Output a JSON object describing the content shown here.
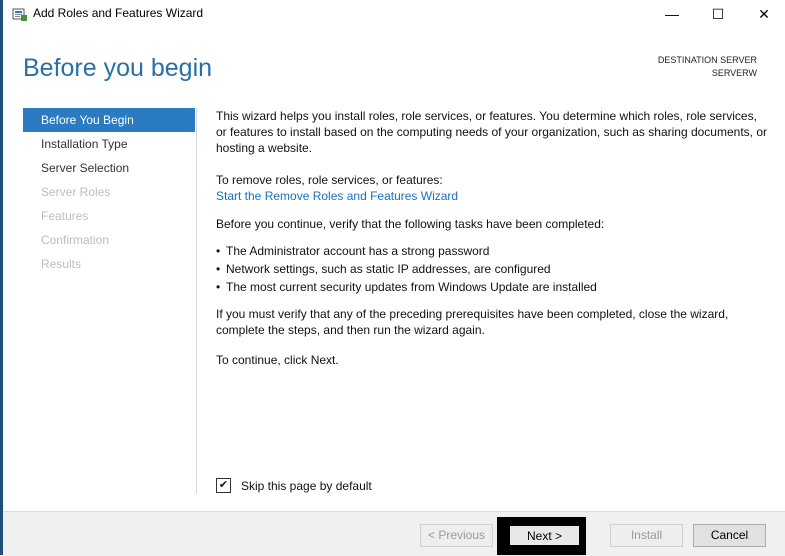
{
  "window": {
    "title": "Add Roles and Features Wizard",
    "minimize_glyph": "—",
    "maximize_glyph": "☐",
    "close_glyph": "✕"
  },
  "header": {
    "page_title": "Before you begin",
    "destination_label": "DESTINATION SERVER",
    "destination_server": "SERVERW"
  },
  "nav": {
    "items": [
      {
        "label": "Before You Begin"
      },
      {
        "label": "Installation Type"
      },
      {
        "label": "Server Selection"
      },
      {
        "label": "Server Roles"
      },
      {
        "label": "Features"
      },
      {
        "label": "Confirmation"
      },
      {
        "label": "Results"
      }
    ]
  },
  "content": {
    "intro": "This wizard helps you install roles, role services, or features. You determine which roles, role services, or features to install based on the computing needs of your organization, such as sharing documents, or hosting a website.",
    "remove_label": "To remove roles, role services, or features:",
    "remove_link": "Start the Remove Roles and Features Wizard",
    "verify_intro": "Before you continue, verify that the following tasks have been completed:",
    "bullets": [
      "The Administrator account has a strong password",
      "Network settings, such as static IP addresses, are configured",
      "The most current security updates from Windows Update are installed"
    ],
    "prereq_note": "If you must verify that any of the preceding prerequisites have been completed, close the wizard, complete the steps, and then run the wizard again.",
    "continue_note": "To continue, click Next."
  },
  "skip": {
    "label": "Skip this page by default",
    "checked_glyph": "✔"
  },
  "footer": {
    "previous": "< Previous",
    "next": "Next >",
    "install": "Install",
    "cancel": "Cancel"
  },
  "icons": {
    "app": "server-manager-icon",
    "checkbox": "check-icon"
  }
}
